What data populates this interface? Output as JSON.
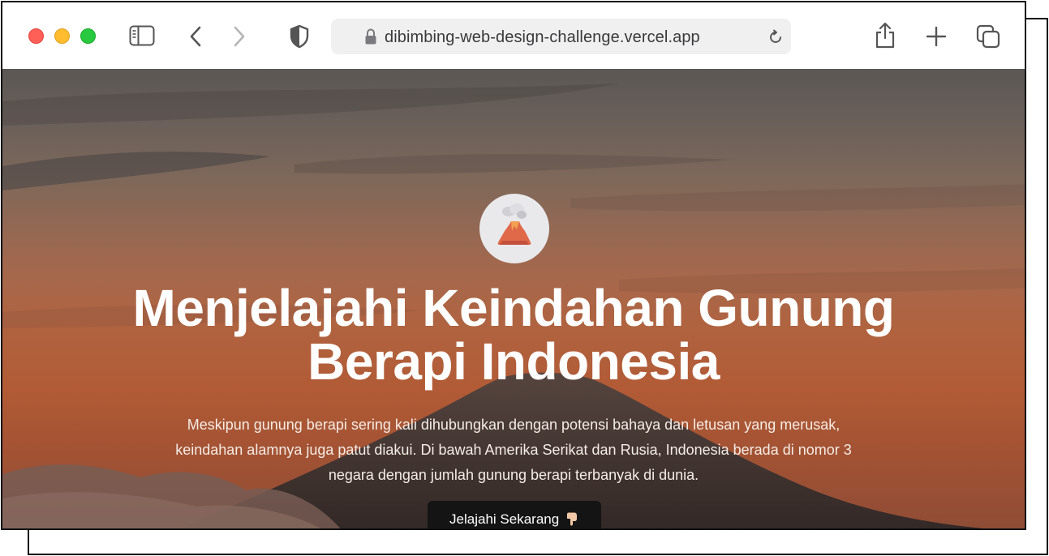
{
  "browser": {
    "url": "dibimbing-web-design-challenge.vercel.app",
    "icons": {
      "sidebar": "sidebar-icon",
      "back": "chevron-left-icon",
      "forward": "chevron-right-icon",
      "privacy": "shield-icon",
      "lock": "lock-icon",
      "reload": "reload-icon",
      "share": "share-icon",
      "new_tab": "plus-icon",
      "tabs": "tabs-overview-icon"
    }
  },
  "hero": {
    "emoji": "volcano",
    "headline_line1": "Menjelajahi Keindahan Gunung",
    "headline_line2": "Berapi Indonesia",
    "subtext_line1": "Meskipun gunung berapi sering kali dihubungkan dengan potensi bahaya dan letusan yang merusak,",
    "subtext_line2": "keindahan alamnya juga patut diakui. Di bawah Amerika Serikat dan Rusia, Indonesia berada di nomor 3",
    "subtext_line3": "negara dengan jumlah gunung berapi terbanyak di dunia.",
    "cta_label": "Jelajahi Sekarang"
  },
  "colors": {
    "cta_background": "#141414",
    "heading": "#ffffff"
  }
}
